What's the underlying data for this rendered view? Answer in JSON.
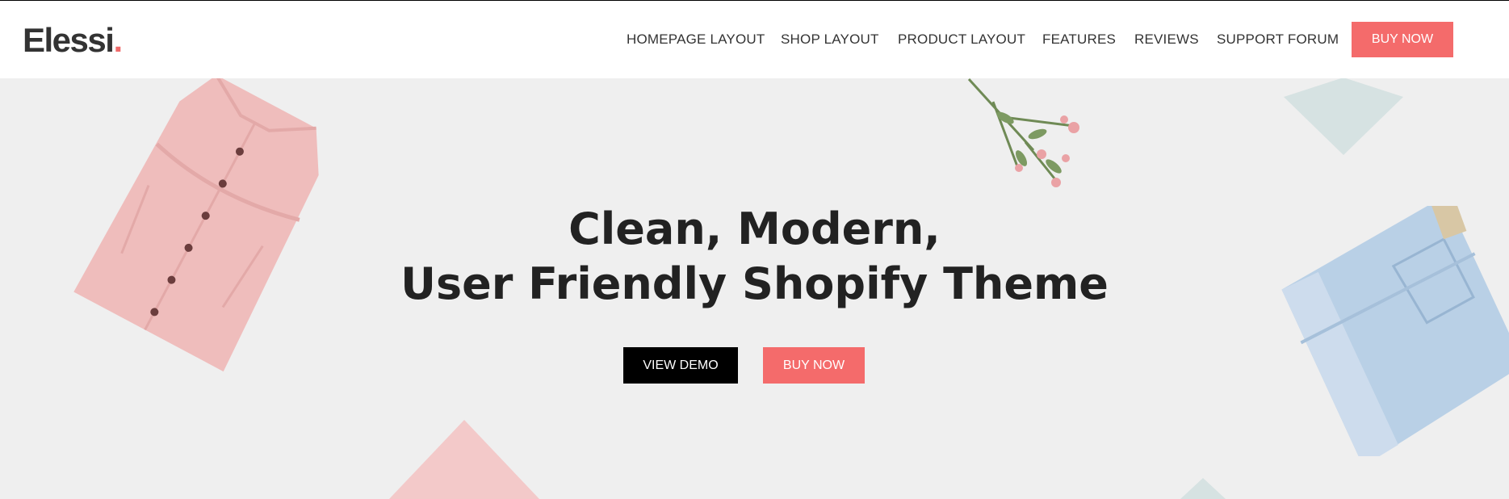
{
  "brand": {
    "name": "Elessi",
    "dot": "."
  },
  "nav": {
    "items": [
      {
        "id": "homepage-layout",
        "label": "HOMEPAGE LAYOUT"
      },
      {
        "id": "shop-layout",
        "label": "SHOP LAYOUT"
      },
      {
        "id": "product-layout",
        "label": "PRODUCT LAYOUT"
      },
      {
        "id": "features",
        "label": "FEATURES"
      },
      {
        "id": "reviews",
        "label": "REVIEWS"
      },
      {
        "id": "support-forum",
        "label": "SUPPORT FORUM"
      }
    ],
    "buy_label": "BUY NOW"
  },
  "hero": {
    "title_line1": "Clean, Modern,",
    "title_line2": "User Friendly Shopify Theme",
    "view_demo_label": "VIEW DEMO",
    "buy_label": "BUY NOW"
  },
  "icons": {
    "dress": "pink-dress-image",
    "flowers": "flower-bouquet-image",
    "jeans": "denim-jeans-image"
  },
  "colors": {
    "accent": "#f46b6b",
    "background": "#efefef",
    "diamond_blue": "#d6e2e2",
    "diamond_pink": "#f3c9c9",
    "dress_pink": "#efbdbc",
    "denim": "#b9d0e6"
  }
}
